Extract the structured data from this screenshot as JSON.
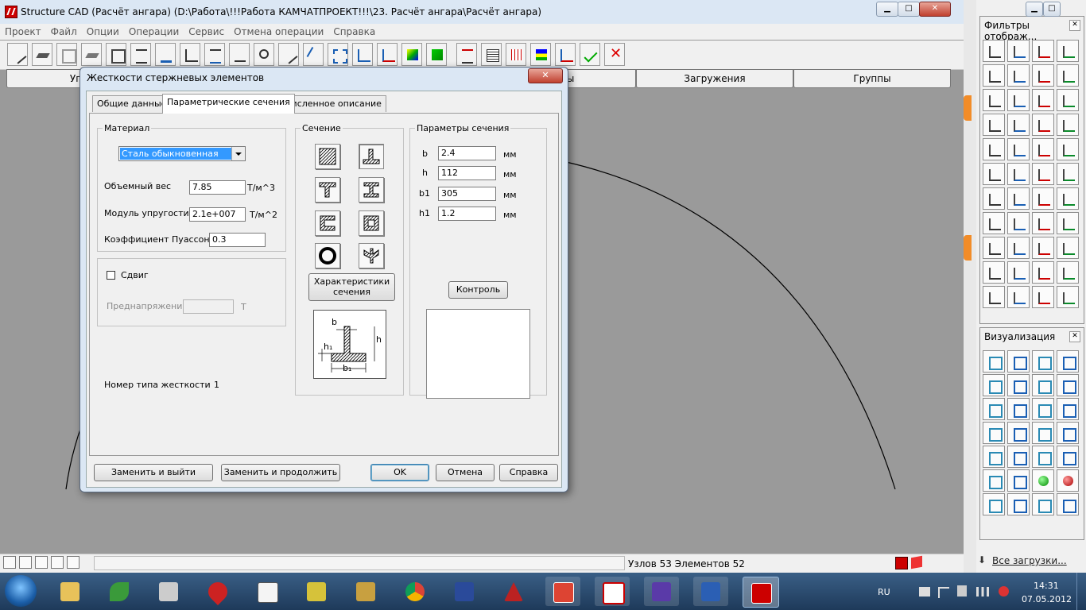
{
  "app": {
    "title": "Structure CAD (Расчёт ангара) (D:\\Работа\\!!!Работа КАМЧАТПРОЕКТ!!!\\23. Расчёт ангара\\Расчёт ангара)",
    "min_glyph": "▁",
    "max_glyph": "□",
    "close_glyph": "✕"
  },
  "menu": [
    "Проект",
    "Файл",
    "Опции",
    "Операции",
    "Сервис",
    "Отмена операции",
    "Справка"
  ],
  "command_tabs": [
    "Упра",
    "менты",
    "Загружения",
    "Группы"
  ],
  "status": {
    "nodes_elements": "Узлов 53 Элементов 52"
  },
  "panels": {
    "filters": {
      "title": "Фильтры отображ...",
      "close": "✕"
    },
    "visual": {
      "title": "Визуализация",
      "close": "✕"
    },
    "downloads": {
      "label": "Все загрузки..."
    }
  },
  "dialog": {
    "title": "Жесткости стержневых элементов",
    "close": "✕",
    "tabs": [
      "Общие данные",
      "Параметрические сечения",
      "Численное описание"
    ],
    "material": {
      "legend": "Материал",
      "selected": "Сталь обыкновенная",
      "weight_label": "Объемный вес",
      "weight_value": "7.85",
      "weight_unit": "Т/м^3",
      "modulus_label": "Модуль упругости",
      "modulus_value": "2.1e+007",
      "modulus_unit": "Т/м^2",
      "poisson_label": "Коэффициент Пуассона",
      "poisson_value": "0.3"
    },
    "shear_label": "Сдвиг",
    "prestress_label": "Преднапряжение",
    "prestress_unit": "Т",
    "stiffness_type_label": "Номер типа жесткости",
    "stiffness_type_value": "1",
    "section": {
      "legend": "Сечение",
      "characteristics_button": "Характеристики сечения"
    },
    "params": {
      "legend": "Параметры сечения",
      "rows": [
        {
          "name": "b",
          "value": "2.4",
          "unit": "мм"
        },
        {
          "name": "h",
          "value": "112",
          "unit": "мм"
        },
        {
          "name": "b1",
          "value": "305",
          "unit": "мм"
        },
        {
          "name": "h1",
          "value": "1.2",
          "unit": "мм"
        }
      ],
      "control_button": "Контроль"
    },
    "diagram_labels": {
      "b": "b",
      "h": "h",
      "h1": "h₁",
      "b1": "b₁"
    },
    "buttons": {
      "replace_exit": "Заменить и выйти",
      "replace_continue": "Заменить и продолжить",
      "ok": "OK",
      "cancel": "Отмена",
      "help": "Справка"
    }
  },
  "taskbar": {
    "lang": "RU",
    "time": "14:31",
    "date": "07.05.2012"
  },
  "colors": {
    "accent_red": "#cc0000",
    "title_bar": "#dbe7f4",
    "selection": "#3399ff",
    "taskbar": "#2a4a6e"
  }
}
